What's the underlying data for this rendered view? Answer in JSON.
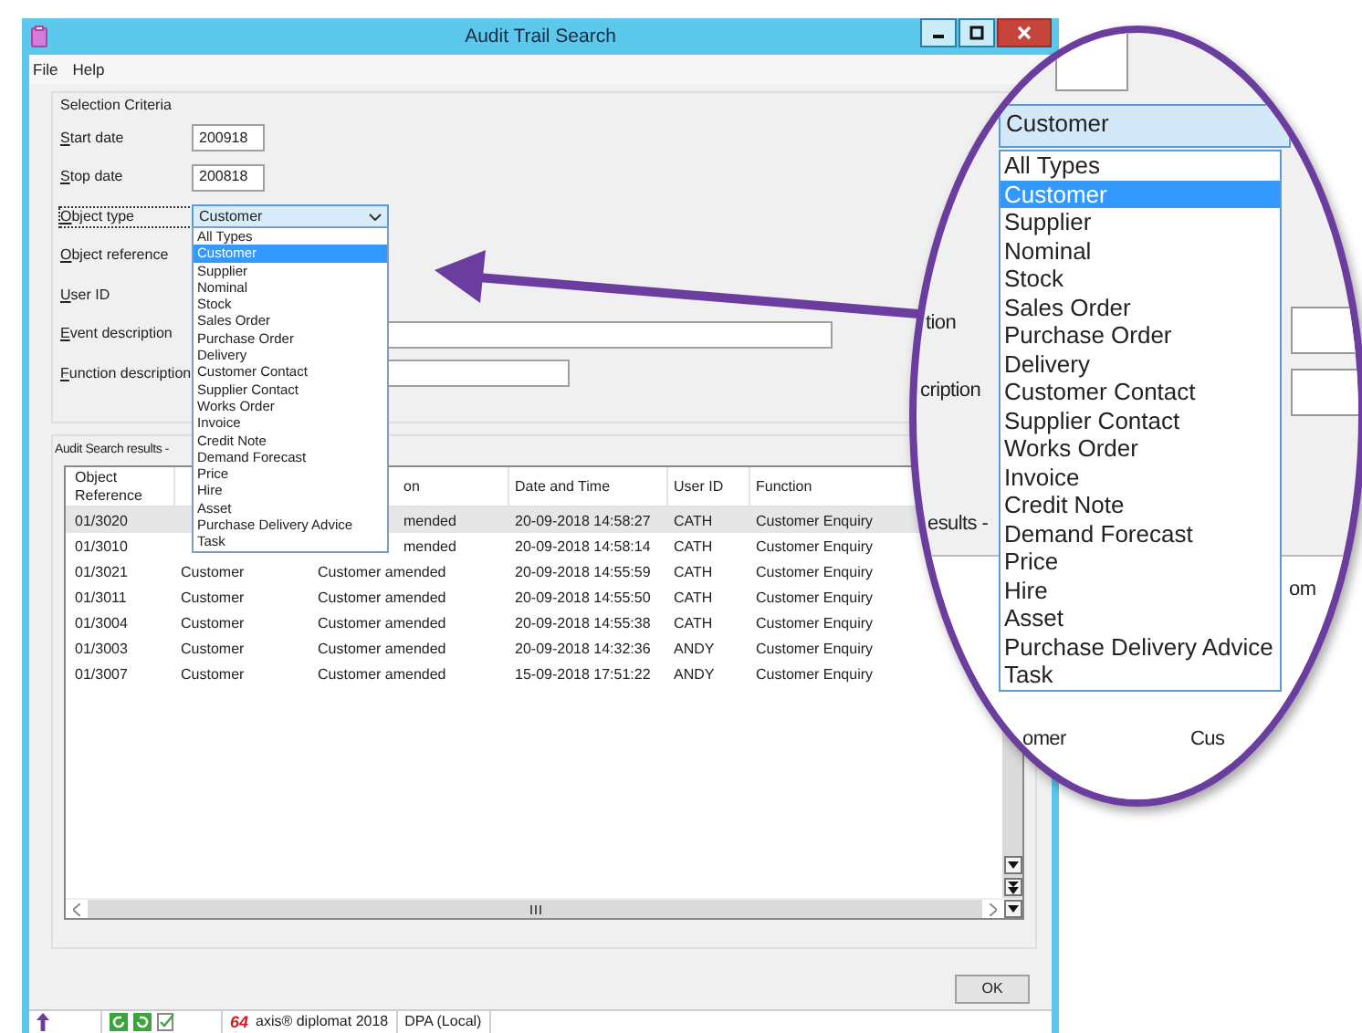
{
  "window": {
    "title": "Audit Trail Search"
  },
  "menu": [
    "File",
    "Help"
  ],
  "selection_criteria": {
    "title": "Selection Criteria",
    "fields": [
      {
        "label": "Start date",
        "kind": "text",
        "value": "200918",
        "focused": false
      },
      {
        "label": "Stop date",
        "kind": "text",
        "value": "200818",
        "focused": false
      },
      {
        "label": "Object type",
        "kind": "combo",
        "value": "Customer",
        "focused": true,
        "expanded": true
      },
      {
        "label": "Object reference",
        "kind": "label",
        "focused": false
      },
      {
        "label": "User ID",
        "kind": "label",
        "focused": false
      },
      {
        "label": "Event description",
        "kind": "text",
        "focused": false
      },
      {
        "label": "Function description",
        "kind": "text",
        "focused": false
      }
    ]
  },
  "object_type_list": [
    {
      "label": "All Types",
      "selected": false
    },
    {
      "label": "Customer",
      "selected": true
    },
    {
      "label": "Supplier",
      "selected": false
    },
    {
      "label": "Nominal",
      "selected": false
    },
    {
      "label": "Stock",
      "selected": false
    },
    {
      "label": "Sales Order",
      "selected": false
    },
    {
      "label": "Purchase Order",
      "selected": false
    },
    {
      "label": "Delivery",
      "selected": false
    },
    {
      "label": "Customer Contact",
      "selected": false
    },
    {
      "label": "Supplier Contact",
      "selected": false
    },
    {
      "label": "Works Order",
      "selected": false
    },
    {
      "label": "Invoice",
      "selected": false
    },
    {
      "label": "Credit Note",
      "selected": false
    },
    {
      "label": "Demand Forecast",
      "selected": false
    },
    {
      "label": "Price",
      "selected": false
    },
    {
      "label": "Hire",
      "selected": false
    },
    {
      "label": "Asset",
      "selected": false
    },
    {
      "label": "Purchase Delivery Advice",
      "selected": false
    },
    {
      "label": "Task",
      "selected": false
    }
  ],
  "results": {
    "title": "Audit Search results -",
    "columns": [
      {
        "label": "Object Reference",
        "covered": false
      },
      {
        "label": "on",
        "covered": true
      },
      {
        "label": "Date and Time",
        "covered": false
      },
      {
        "label": "User ID",
        "covered": false
      },
      {
        "label": "Function",
        "covered": false
      }
    ],
    "rows": [
      {
        "selected": true,
        "covered": true,
        "cells": [
          "01/3020",
          "mended",
          "20-09-2018 14:58:27",
          "CATH",
          "Customer Enquiry"
        ]
      },
      {
        "selected": false,
        "covered": true,
        "cells": [
          "01/3010",
          "mended",
          "20-09-2018 14:58:14",
          "CATH",
          "Customer Enquiry"
        ]
      },
      {
        "selected": false,
        "covered": false,
        "cells": [
          "01/3021",
          "Customer",
          "Customer amended",
          "20-09-2018 14:55:59",
          "CATH",
          "Customer Enquiry"
        ]
      },
      {
        "selected": false,
        "covered": false,
        "cells": [
          "01/3011",
          "Customer",
          "Customer amended",
          "20-09-2018 14:55:50",
          "CATH",
          "Customer Enquiry"
        ]
      },
      {
        "selected": false,
        "covered": false,
        "cells": [
          "01/3004",
          "Customer",
          "Customer amended",
          "20-09-2018 14:55:38",
          "CATH",
          "Customer Enquiry"
        ]
      },
      {
        "selected": false,
        "covered": false,
        "cells": [
          "01/3003",
          "Customer",
          "Customer amended",
          "20-09-2018 14:32:36",
          "ANDY",
          "Customer Enquiry"
        ]
      },
      {
        "selected": false,
        "covered": false,
        "cells": [
          "01/3007",
          "Customer",
          "Customer amended",
          "15-09-2018 17:51:22",
          "ANDY",
          "Customer Enquiry"
        ]
      }
    ]
  },
  "ok_button": "OK",
  "status_bar": {
    "logo": "64",
    "product": "axis® diplomat 2018",
    "database": "DPA (Local)"
  },
  "callout": {
    "combo_value": "Customer",
    "items": [
      {
        "label": "All Types",
        "selected": false
      },
      {
        "label": "Customer",
        "selected": true
      },
      {
        "label": "Supplier",
        "selected": false
      },
      {
        "label": "Nominal",
        "selected": false
      },
      {
        "label": "Stock",
        "selected": false
      },
      {
        "label": "Sales Order",
        "selected": false
      },
      {
        "label": "Purchase Order",
        "selected": false
      },
      {
        "label": "Delivery",
        "selected": false
      },
      {
        "label": "Customer Contact",
        "selected": false
      },
      {
        "label": "Supplier Contact",
        "selected": false
      },
      {
        "label": "Works Order",
        "selected": false
      },
      {
        "label": "Invoice",
        "selected": false
      },
      {
        "label": "Credit Note",
        "selected": false
      },
      {
        "label": "Demand Forecast",
        "selected": false
      },
      {
        "label": "Price",
        "selected": false
      },
      {
        "label": "Hire",
        "selected": false
      },
      {
        "label": "Asset",
        "selected": false
      },
      {
        "label": "Purchase Delivery Advice",
        "selected": false
      },
      {
        "label": "Task",
        "selected": false
      }
    ],
    "fragments": [
      "tion",
      "cription",
      "esults -",
      "om",
      "omer",
      "Cus"
    ]
  }
}
